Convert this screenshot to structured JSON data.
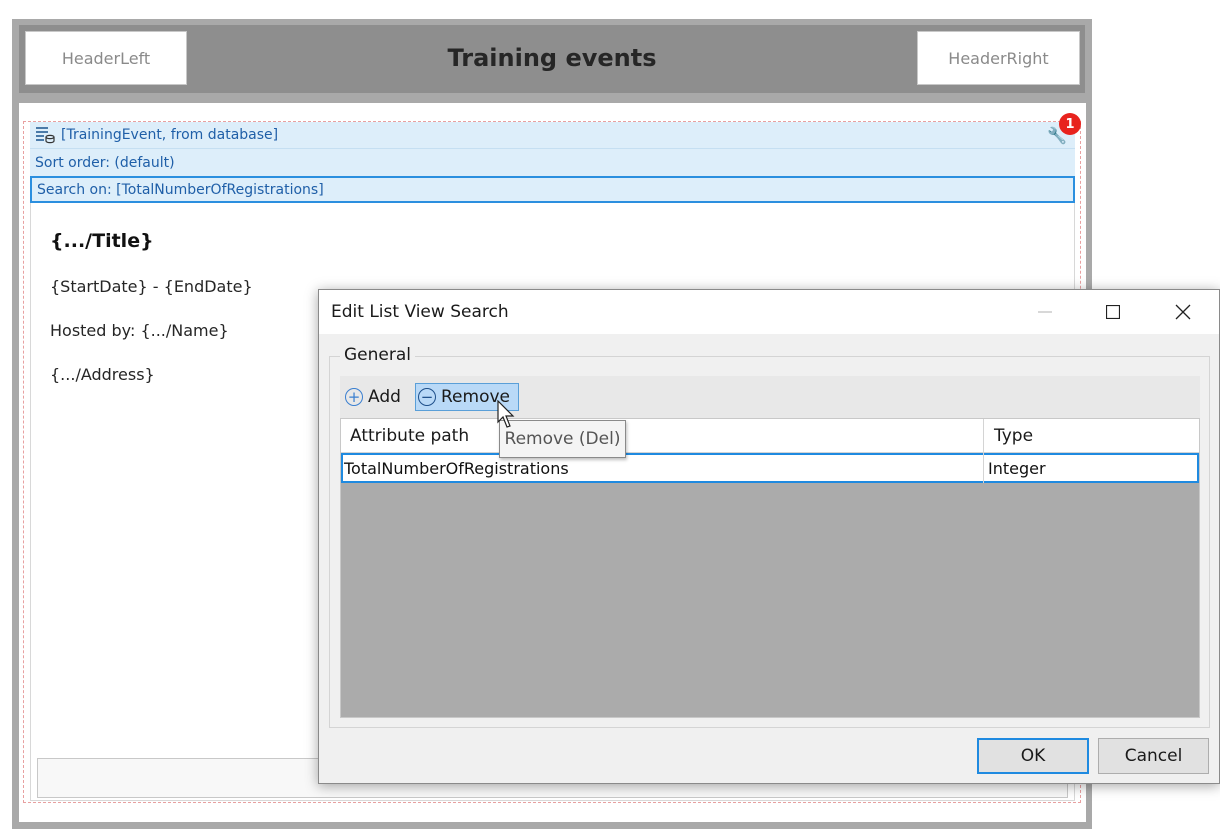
{
  "header": {
    "left_label": "HeaderLeft",
    "title": "Training events",
    "right_label": "HeaderRight"
  },
  "list_view": {
    "source": "[TrainingEvent, from database]",
    "sort_order": "Sort order: (default)",
    "search_on": "Search on: [TotalNumberOfRegistrations]",
    "error_count": "1",
    "source_icon": "list-database-icon",
    "settings_icon": "wrench-icon",
    "item": {
      "title": "{.../Title}",
      "dates": "{StartDate} - {EndDate}",
      "hosted_by": "Hosted by: {.../Name}",
      "address": "{.../Address}"
    }
  },
  "dialog": {
    "title": "Edit List View Search",
    "group_label": "General",
    "toolbar": {
      "add_label": "Add",
      "remove_label": "Remove"
    },
    "tooltip": "Remove (Del)",
    "grid": {
      "columns": [
        "Attribute path",
        "Type"
      ],
      "rows": [
        {
          "attribute_path": "TotalNumberOfRegistrations",
          "type": "Integer"
        }
      ]
    },
    "ok_label": "OK",
    "cancel_label": "Cancel"
  },
  "colors": {
    "accent": "#1f8ae0",
    "badge": "#e8231e",
    "list_header_bg": "#ddeefa",
    "selected_button_bg": "#b9d9f7"
  }
}
